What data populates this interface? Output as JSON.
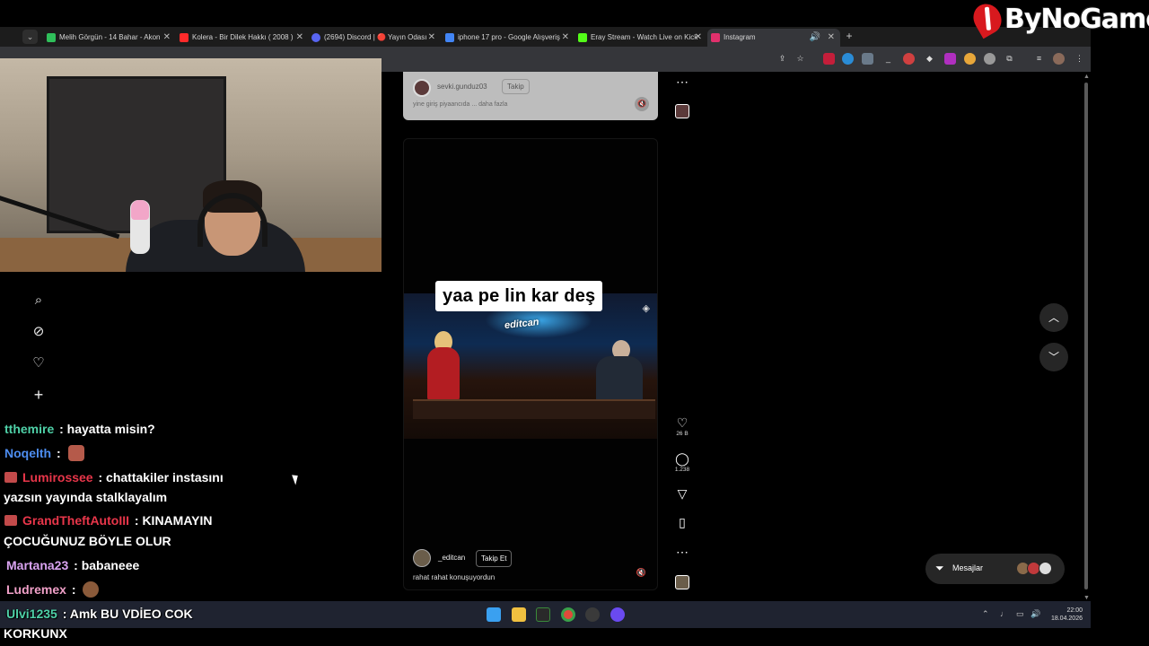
{
  "brand": {
    "logo_text": "ByNoGame"
  },
  "browser": {
    "tabs": [
      {
        "label": "Melih Görgün - 14 Bahar - Akon",
        "favicon_color": "#2fbf5a"
      },
      {
        "label": "Kolera - Bir Dilek Hakkı ( 2008 )",
        "favicon_color": "#ff2a2a"
      },
      {
        "label": "(2694) Discord | 🔴 Yayın Odası",
        "favicon_color": "#5865f2"
      },
      {
        "label": "iphone 17 pro - Google Alışveriş",
        "favicon_color": "#4285f4"
      },
      {
        "label": "Eray Stream - Watch Live on Kick",
        "favicon_color": "#53fc18"
      },
      {
        "label": "Instagram",
        "favicon_color": "#e1306c"
      }
    ],
    "new_tab_label": "+",
    "tab_close_label": "✕"
  },
  "instagram": {
    "reel_top": {
      "username": "sevki.gunduz03",
      "follow_label": "Takip",
      "caption": "yine giriş piyaancıda ... daha fazla"
    },
    "reel_main": {
      "video_caption": "yaa pe lin kar deş",
      "watermark": "editcan",
      "username": "_editcan",
      "follow_label": "Takip Et",
      "caption": "rahat rahat konuşuyordun"
    },
    "actions": {
      "likes": "26 B",
      "comments": "1.238"
    },
    "messages_label": "Mesajlar"
  },
  "chat": [
    {
      "user": "tthemire",
      "user_color": "#4fd1a8",
      "text": ": hayatta misin?"
    },
    {
      "user": "Noqelth",
      "user_color": "#4d8df0",
      "text": ":"
    },
    {
      "user": "Lumirossee",
      "user_color": "#e8364a",
      "text": ": chattakiler instasını",
      "cont": "yazsın yayında stalklayalım"
    },
    {
      "user": "GrandTheftAutoIII",
      "user_color": "#e8364a",
      "text": ": KINAMAYIN",
      "cont": "ÇOCUĞUNUZ BÖYLE OLUR"
    },
    {
      "user": "Martana23",
      "user_color": "#d9a3f0",
      "text": ": babaneee"
    },
    {
      "user": "Ludremex",
      "user_color": "#f0a0c8",
      "text": ":"
    },
    {
      "user": "Ulvi1235",
      "user_color": "#4fd1a8",
      "text": ": Amk BU VDİEO COK",
      "cont": "KORKUNX"
    }
  ],
  "taskbar": {
    "time": "22:00",
    "date": "18.04.2026"
  }
}
